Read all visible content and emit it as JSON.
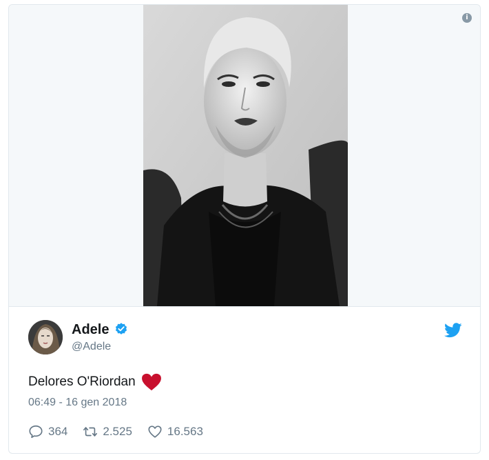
{
  "tweet": {
    "author": {
      "display_name": "Adele",
      "handle": "@Adele",
      "verified": true
    },
    "text": "Delores O'Riordan",
    "emoji": "red-heart",
    "timestamp": "06:49 - 16 gen 2018",
    "stats": {
      "replies": "364",
      "retweets": "2.525",
      "likes": "16.563"
    }
  },
  "icons": {
    "info": "info-icon",
    "verified": "verified-badge-icon",
    "brand": "twitter-bird-icon",
    "reply": "reply-icon",
    "retweet": "retweet-icon",
    "like": "heart-icon"
  },
  "colors": {
    "brand": "#1da1f2",
    "heart": "#c8102e",
    "muted": "#657786"
  }
}
